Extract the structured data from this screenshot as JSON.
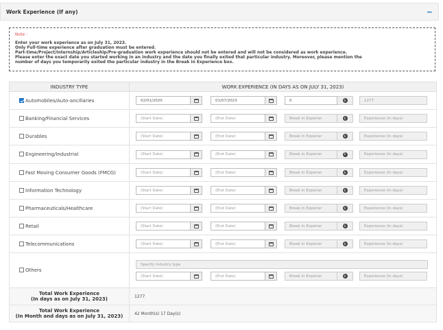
{
  "section": {
    "title": "Work Experience (If any)",
    "collapse_icon": "−"
  },
  "note": {
    "label": "Note :",
    "lines": [
      "Enter your work experience as on July 31, 2023.",
      "Only Full-time experience after graduation must be entered.",
      "Part-time/Project/Internship/Articleship/Pre-graduation work experience should not be entered and will not be considered as work experience.",
      "Please enter the exact date you started working in an industry and the date you finally exited that particular industry. Moreover, please mention the",
      "number of days you temporarily exited the particular industry in the Break in Experience box."
    ]
  },
  "table": {
    "headers": {
      "industry": "INDUSTRY TYPE",
      "experience": "WORK EXPERIENCE (IN DAYS AS ON JULY 31, 2023)"
    },
    "placeholders": {
      "start": "(Start Date)",
      "end": "(End Date)",
      "break": "Break in Experier",
      "experience": "Experience (In days)",
      "specify": "Specify Industry type"
    },
    "rows": [
      {
        "label": "Automobiles/Auto-ancillaries",
        "checked": true,
        "start": "02/01/2020",
        "end": "01/07/2023",
        "break": "0",
        "experience": "1277"
      },
      {
        "label": "Banking/Financial Services",
        "checked": false
      },
      {
        "label": "Durables",
        "checked": false
      },
      {
        "label": "Engineering/Industrial",
        "checked": false
      },
      {
        "label": "Fast Moving Consumer Goods (FMCG)",
        "checked": false
      },
      {
        "label": "Information Technology",
        "checked": false
      },
      {
        "label": "Pharmaceuticals/Healthcare",
        "checked": false
      },
      {
        "label": "Retail",
        "checked": false
      },
      {
        "label": "Telecommunications",
        "checked": false
      },
      {
        "label": "Others",
        "checked": false
      }
    ]
  },
  "summary": {
    "total_days_label_1": "Total Work Experience",
    "total_days_label_2": "(In days as on July 31, 2023)",
    "total_days_value": "1277",
    "total_months_label_1": "Total Work Experience",
    "total_months_label_2": "(In Month and days as on July 31, 2023)",
    "total_months_value": "42 Month(s) 17 Day(s)"
  },
  "colors": {
    "accent": "#1a73c8",
    "note_label": "#d9534f"
  },
  "icons": {
    "calendar": "calendar-icon",
    "info": "info-icon",
    "checkbox": "checkbox-icon"
  }
}
